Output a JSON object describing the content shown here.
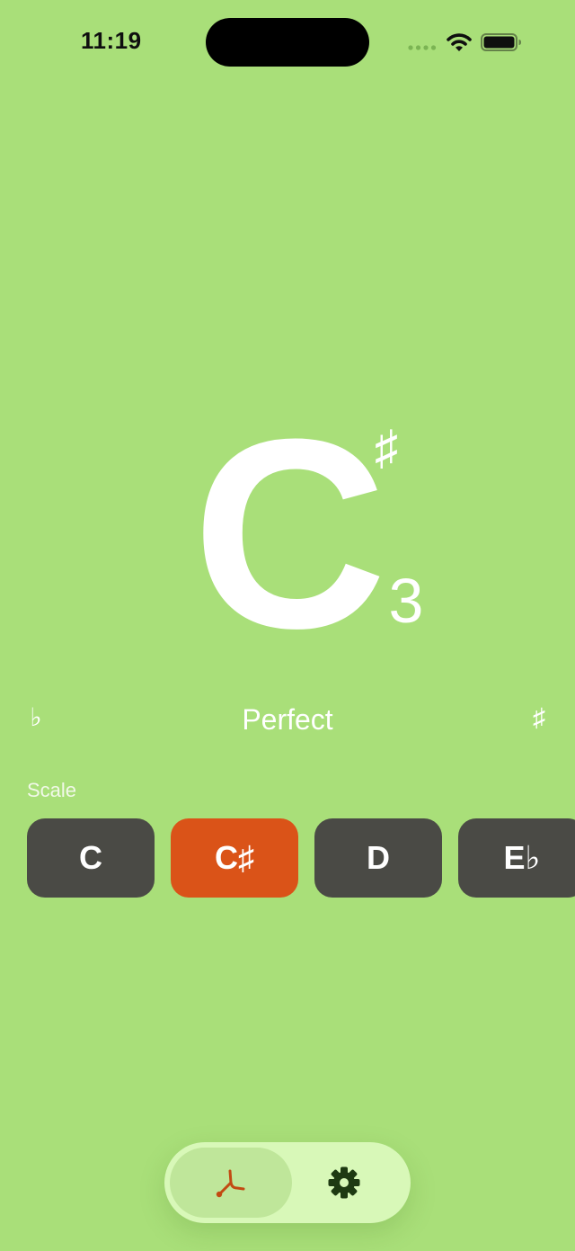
{
  "status_bar": {
    "time": "11:19"
  },
  "tuner": {
    "note": "C",
    "accidental": "♯",
    "octave": "3",
    "status": "Perfect",
    "flat_symbol": "♭",
    "sharp_symbol": "♯"
  },
  "scale": {
    "label": "Scale",
    "selected": "C♯",
    "notes": [
      "C",
      "C♯",
      "D",
      "E♭"
    ]
  },
  "tab_bar": {
    "tabs": [
      {
        "name": "tuner",
        "icon": "tuning-fork-icon",
        "selected": true
      },
      {
        "name": "settings",
        "icon": "gear-icon",
        "selected": false
      }
    ]
  },
  "colors": {
    "background": "#A9DF79",
    "chip": "#4A4A45",
    "chip_selected": "#DA5318",
    "tab_bar": "#D8F8B8",
    "tab_selected": "#BFE69A",
    "tuning_fork_icon": "#C24A12",
    "gear_icon": "#1E3A12"
  }
}
